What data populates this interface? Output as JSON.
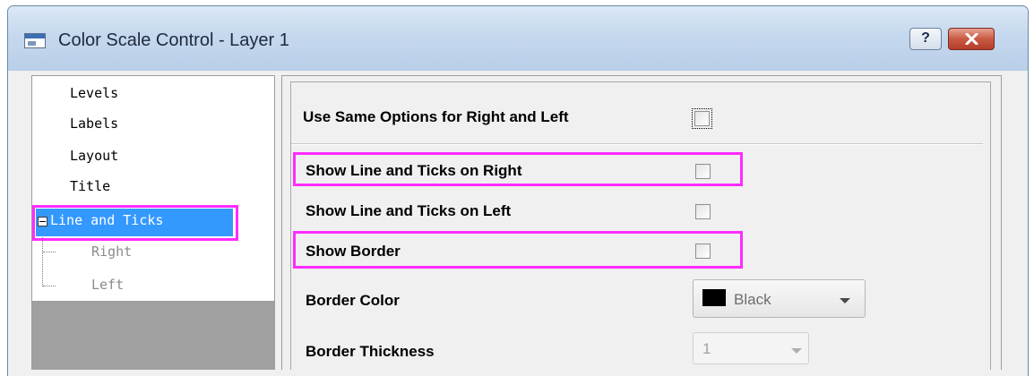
{
  "window": {
    "title": "Color Scale Control - Layer 1",
    "help_label": "?",
    "icons": {
      "app": "window-app-icon",
      "close": "close-x-icon"
    }
  },
  "tree": {
    "items": [
      {
        "label": "Levels"
      },
      {
        "label": "Labels"
      },
      {
        "label": "Layout"
      },
      {
        "label": "Title"
      },
      {
        "label": "Line and Ticks",
        "selected": true,
        "expanded": true
      },
      {
        "label": "Right",
        "child": true
      },
      {
        "label": "Left",
        "child": true
      }
    ]
  },
  "options": {
    "same_options_label": "Use Same Options for Right and Left",
    "same_options_checked": false,
    "show_right_label": "Show Line and Ticks on Right",
    "show_right_checked": false,
    "show_left_label": "Show Line and Ticks on Left",
    "show_left_checked": false,
    "show_border_label": "Show Border",
    "show_border_checked": false,
    "border_color_label": "Border Color",
    "border_color_value": "Black",
    "border_color_swatch": "#000000",
    "border_thickness_label": "Border Thickness",
    "border_thickness_value": "1"
  },
  "colors": {
    "selection": "#3399ff",
    "highlight": "#ff2cff",
    "close_button": "#c85a44"
  }
}
